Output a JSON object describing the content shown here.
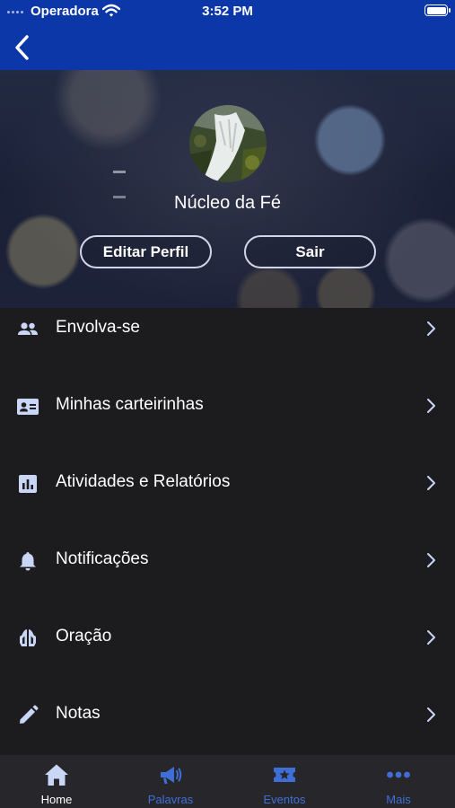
{
  "status_bar": {
    "carrier": "Operadora",
    "time": "3:52 PM"
  },
  "nav": {
    "back_icon": "chevron-left-icon"
  },
  "profile": {
    "name": "Núcleo da Fé",
    "edit_label": "Editar Perfil",
    "logout_label": "Sair"
  },
  "menu": {
    "items": [
      {
        "label": "Envolva-se",
        "icon": "people-icon"
      },
      {
        "label": "Minhas carteirinhas",
        "icon": "id-card-icon"
      },
      {
        "label": "Atividades e Relatórios",
        "icon": "chart-icon"
      },
      {
        "label": "Notificações",
        "icon": "bell-icon"
      },
      {
        "label": "Oração",
        "icon": "praying-hands-icon"
      },
      {
        "label": "Notas",
        "icon": "pencil-icon"
      }
    ]
  },
  "tabbar": {
    "tabs": [
      {
        "label": "Home",
        "icon": "home-icon",
        "active": true
      },
      {
        "label": "Palavras",
        "icon": "megaphone-icon",
        "active": false
      },
      {
        "label": "Eventos",
        "icon": "ticket-star-icon",
        "active": false
      },
      {
        "label": "Mais",
        "icon": "more-dots-icon",
        "active": false
      }
    ]
  },
  "colors": {
    "header_blue": "#0b37a8",
    "background": "#1c1c1e",
    "tabbar": "#27272b",
    "icon_tint": "#c9d6f5",
    "tab_active": "#ffffff",
    "tab_inactive": "#3f6fd6"
  }
}
